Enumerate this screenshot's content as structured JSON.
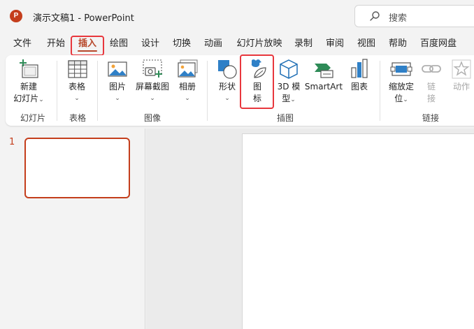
{
  "titlebar": {
    "app_logo_letter": "P",
    "doc_title": "演示文稿1  -  PowerPoint",
    "search_label": "搜索"
  },
  "tabs": [
    {
      "label": "文件"
    },
    {
      "label": "开始"
    },
    {
      "label": "插入",
      "active": true
    },
    {
      "label": "绘图"
    },
    {
      "label": "设计"
    },
    {
      "label": "切换"
    },
    {
      "label": "动画"
    },
    {
      "label": "幻灯片放映"
    },
    {
      "label": "录制"
    },
    {
      "label": "审阅"
    },
    {
      "label": "视图"
    },
    {
      "label": "帮助"
    },
    {
      "label": "百度网盘"
    }
  ],
  "ribbon": {
    "groups": {
      "slides": "幻灯片",
      "tables": "表格",
      "images": "图像",
      "illustrations": "插图",
      "links": "链接"
    },
    "buttons": {
      "new_slide_1": "新建",
      "new_slide_2": "幻灯片",
      "table": "表格",
      "pictures": "图片",
      "screenshot": "屏幕截图",
      "album": "相册",
      "shapes": "形状",
      "icons_1": "图",
      "icons_2": "标",
      "model3d_1": "3D 模",
      "model3d_2": "型",
      "smartart": "SmartArt",
      "chart": "图表",
      "zoom_1": "缩放定",
      "zoom_2": "位",
      "link_1": "链",
      "link_2": "接",
      "action": "动作"
    },
    "chevron": "⌄"
  },
  "slides_pane": {
    "slide_number": "1"
  },
  "colors": {
    "accent": "#c43e1c",
    "highlight_box": "#e8373d"
  }
}
